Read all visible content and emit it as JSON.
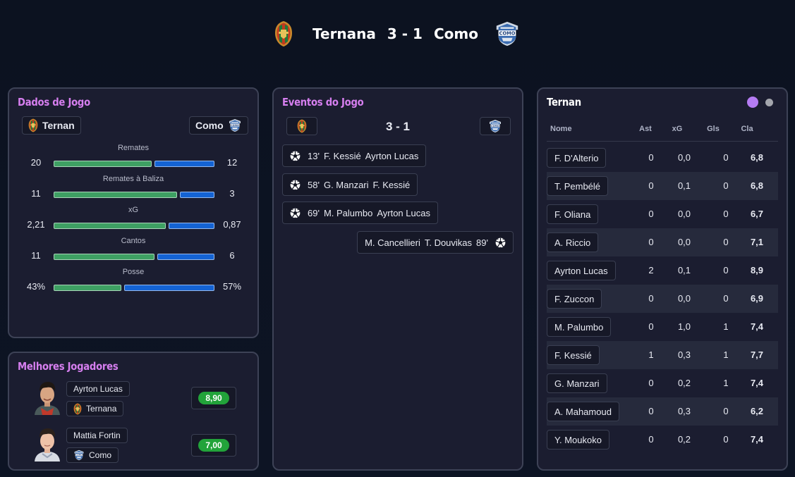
{
  "header": {
    "home_team": "Ternana",
    "score": "3 - 1",
    "away_team": "Como",
    "home_badge_icon": "ternana-crest-icon",
    "away_badge_icon": "como-crest-icon"
  },
  "match_stats": {
    "title": "Dados de Jogo",
    "home_team": "Ternan",
    "away_team": "Como",
    "stats": [
      {
        "label": "Remates",
        "home": "20",
        "away": "12",
        "home_share": 0.62
      },
      {
        "label": "Remates à Baliza",
        "home": "11",
        "away": "3",
        "home_share": 0.78
      },
      {
        "label": "xG",
        "home": "2,21",
        "away": "0,87",
        "home_share": 0.71
      },
      {
        "label": "Cantos",
        "home": "11",
        "away": "6",
        "home_share": 0.64
      },
      {
        "label": "Posse",
        "home": "43%",
        "away": "57%",
        "home_share": 0.43
      }
    ],
    "colors": {
      "home": "#3ea063",
      "away": "#1463d4"
    }
  },
  "best_players": {
    "title": "Melhores Jogadores",
    "players": [
      {
        "name": "Ayrton Lucas",
        "team": "Ternana",
        "rating": "8,90"
      },
      {
        "name": "Mattia Fortin",
        "team": "Como",
        "rating": "7,00"
      }
    ]
  },
  "events": {
    "title": "Eventos do Jogo",
    "score": "3 - 1",
    "items": [
      {
        "side": "home",
        "minute": "13'",
        "scorer": "F. Kessié",
        "assist": "Ayrton Lucas",
        "icon": "football-icon"
      },
      {
        "side": "home",
        "minute": "58'",
        "scorer": "G. Manzari",
        "assist": "F. Kessié",
        "icon": "football-icon"
      },
      {
        "side": "home",
        "minute": "69'",
        "scorer": "M. Palumbo",
        "assist": "Ayrton Lucas",
        "icon": "football-icon"
      },
      {
        "side": "away",
        "minute": "89'",
        "scorer": "T. Douvikas",
        "assist": "M. Cancellieri",
        "icon": "football-icon"
      }
    ]
  },
  "lineup": {
    "title": "Ternan",
    "toggle_colors": {
      "active": "#b57cf3",
      "inactive": "#a4a6ad"
    },
    "columns": [
      "Nome",
      "Ast",
      "xG",
      "Gls",
      "Cla"
    ],
    "rows": [
      {
        "name": "F. D'Alterio",
        "ast": "0",
        "xg": "0,0",
        "gls": "0",
        "cla": "6,8"
      },
      {
        "name": "T. Pembélé",
        "ast": "0",
        "xg": "0,1",
        "gls": "0",
        "cla": "6,8"
      },
      {
        "name": "F. Oliana",
        "ast": "0",
        "xg": "0,0",
        "gls": "0",
        "cla": "6,7"
      },
      {
        "name": "A. Riccio",
        "ast": "0",
        "xg": "0,0",
        "gls": "0",
        "cla": "7,1"
      },
      {
        "name": "Ayrton Lucas",
        "ast": "2",
        "xg": "0,1",
        "gls": "0",
        "cla": "8,9"
      },
      {
        "name": "F. Zuccon",
        "ast": "0",
        "xg": "0,0",
        "gls": "0",
        "cla": "6,9"
      },
      {
        "name": "M. Palumbo",
        "ast": "0",
        "xg": "1,0",
        "gls": "1",
        "cla": "7,4"
      },
      {
        "name": "F. Kessié",
        "ast": "1",
        "xg": "0,3",
        "gls": "1",
        "cla": "7,7"
      },
      {
        "name": "G. Manzari",
        "ast": "0",
        "xg": "0,2",
        "gls": "1",
        "cla": "7,4"
      },
      {
        "name": "A. Mahamoud",
        "ast": "0",
        "xg": "0,3",
        "gls": "0",
        "cla": "6,2"
      },
      {
        "name": "Y. Moukoko",
        "ast": "0",
        "xg": "0,2",
        "gls": "0",
        "cla": "7,4"
      }
    ]
  }
}
